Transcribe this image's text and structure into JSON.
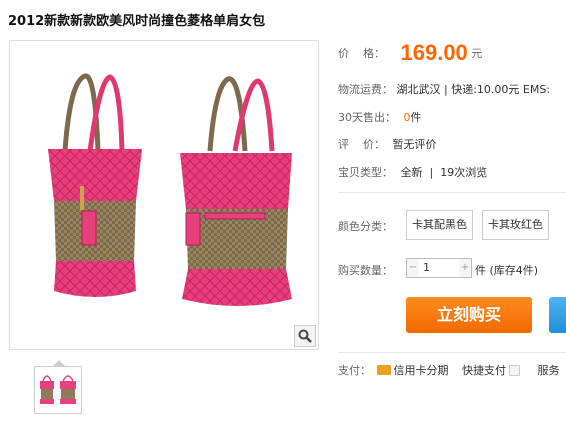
{
  "title": "2012新款新款欧美风时尚撞色菱格单肩女包",
  "price": {
    "label": "价    格：",
    "value": "169.00",
    "unit": "元"
  },
  "shipping": {
    "label": "物流运费：",
    "value": "湖北武汉 | 快递:10.00元 EMS:"
  },
  "sold": {
    "label": "30天售出：",
    "value": "0",
    "unit": "件"
  },
  "rating": {
    "label": "评    价：",
    "value": "暂无评价"
  },
  "item_type": {
    "label": "宝贝类型：",
    "value": "全新  |  19次浏览"
  },
  "color": {
    "label": "颜色分类：",
    "options": [
      "卡其配黑色",
      "卡其玫红色"
    ]
  },
  "quantity": {
    "label": "购买数量：",
    "value": "1",
    "stock": "件 (库存4件)"
  },
  "buy_button": "立刻购买",
  "payment": {
    "label": "支付：",
    "credit": "信用卡分期",
    "quick": "快捷支付",
    "service": "服务"
  },
  "colors": {
    "accent": "#ff6600",
    "button": "#f26a00",
    "bag_pink": "#e63a78",
    "bag_khaki": "#8f7a5a"
  }
}
